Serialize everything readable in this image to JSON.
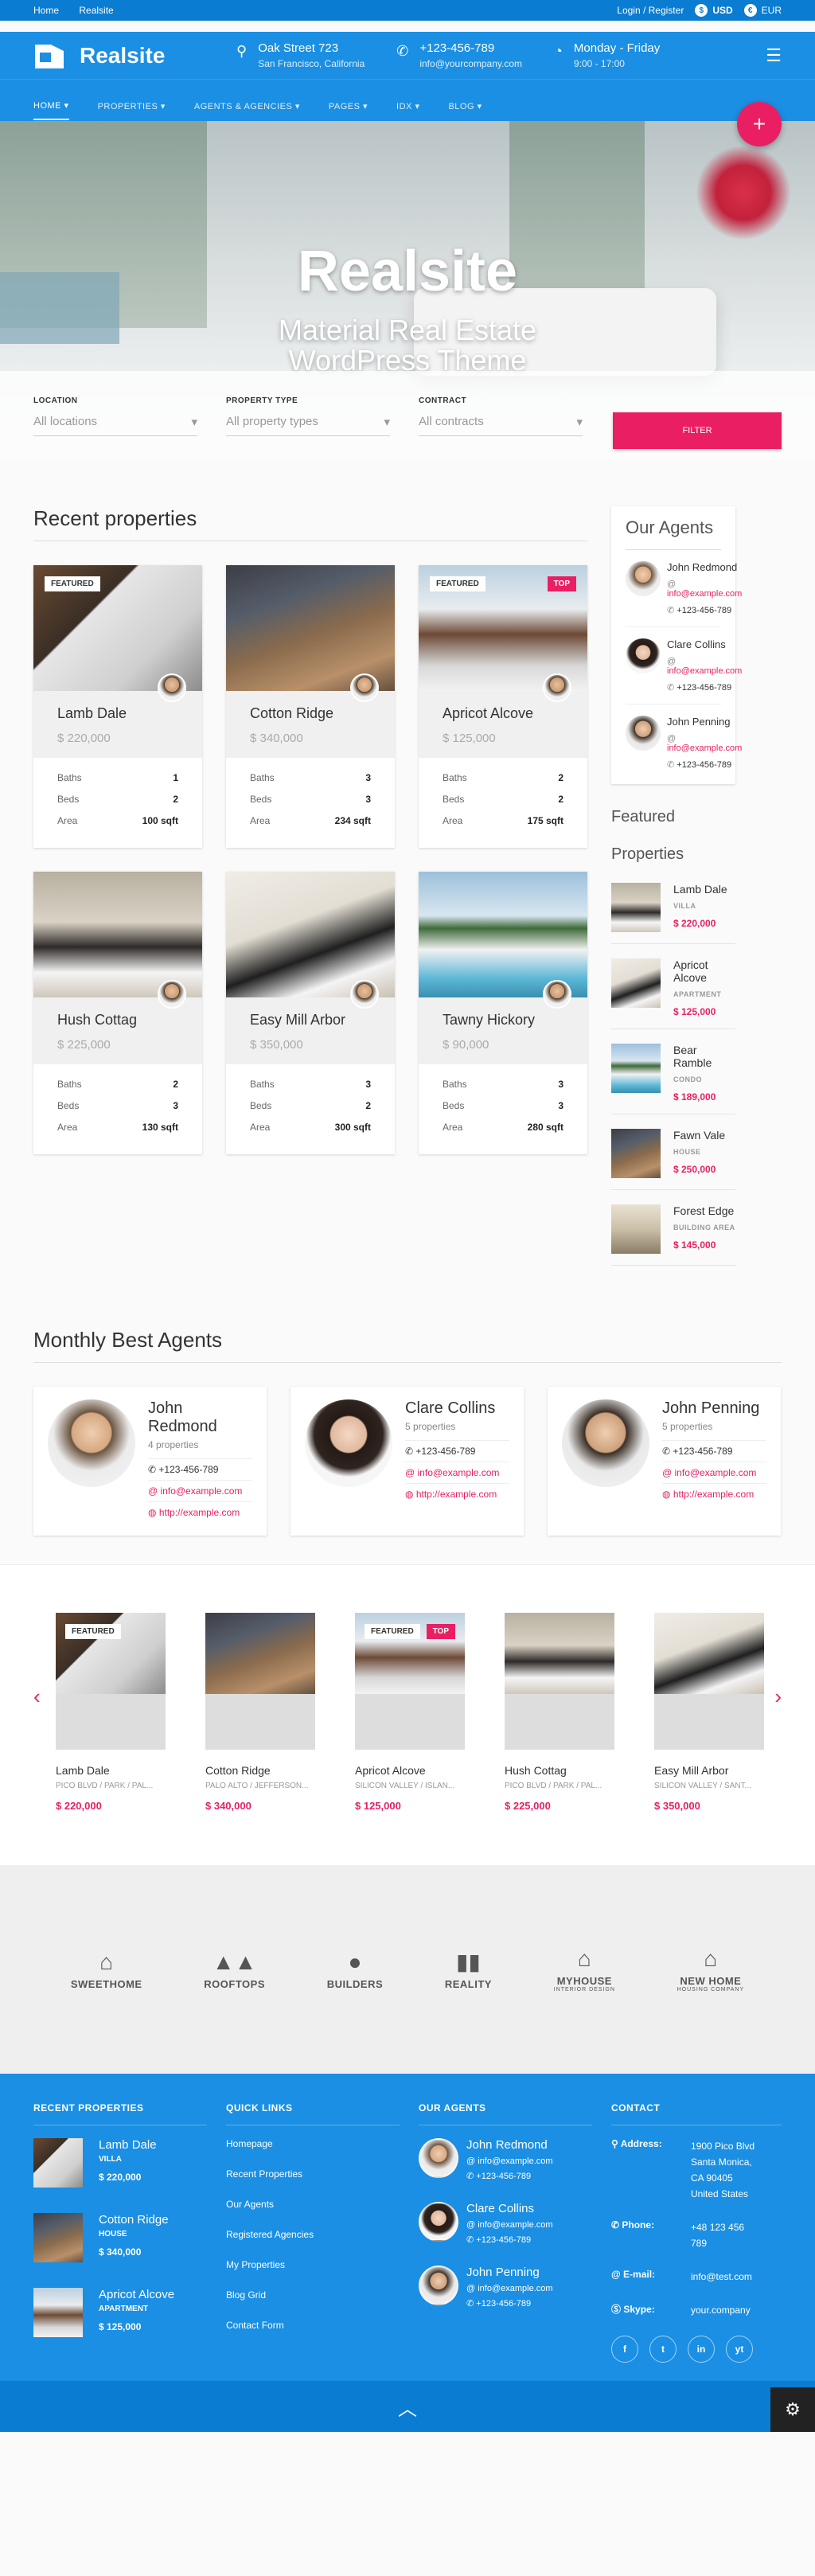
{
  "topbar": {
    "home": "Home",
    "site": "Realsite",
    "login": "Login / Register",
    "usd": "USD",
    "eur": "EUR"
  },
  "header": {
    "logo": "Realsite",
    "addr1": "Oak Street 723",
    "addr2": "San Francisco, California",
    "phone": "+123-456-789",
    "email": "info@yourcompany.com",
    "days": "Monday - Friday",
    "hours": "9:00 - 17:00"
  },
  "nav": [
    "HOME",
    "PROPERTIES",
    "AGENTS & AGENCIES",
    "PAGES",
    "IDX",
    "BLOG"
  ],
  "hero": {
    "title": "Realsite",
    "subtitle1": "Material Real Estate",
    "subtitle2": "WordPress Theme"
  },
  "search": {
    "location_label": "LOCATION",
    "location_val": "All locations",
    "type_label": "PROPERTY TYPE",
    "type_val": "All property types",
    "contract_label": "CONTRACT",
    "contract_val": "All contracts",
    "filter": "FILTER"
  },
  "recent": {
    "title": "Recent properties",
    "baths": "Baths",
    "beds": "Beds",
    "area": "Area",
    "featured": "FEATURED",
    "top": "TOP",
    "items": [
      {
        "name": "Lamb Dale",
        "price": "$ 220,000",
        "baths": "1",
        "beds": "2",
        "area": "100 sqft"
      },
      {
        "name": "Cotton Ridge",
        "price": "$ 340,000",
        "baths": "3",
        "beds": "3",
        "area": "234 sqft"
      },
      {
        "name": "Apricot Alcove",
        "price": "$ 125,000",
        "baths": "2",
        "beds": "2",
        "area": "175 sqft"
      },
      {
        "name": "Hush Cottag",
        "price": "$ 225,000",
        "baths": "2",
        "beds": "3",
        "area": "130 sqft"
      },
      {
        "name": "Easy Mill Arbor",
        "price": "$ 350,000",
        "baths": "3",
        "beds": "2",
        "area": "300 sqft"
      },
      {
        "name": "Tawny Hickory",
        "price": "$ 90,000",
        "baths": "3",
        "beds": "3",
        "area": "280 sqft"
      }
    ]
  },
  "our_agents": {
    "title": "Our Agents",
    "items": [
      {
        "name": "John Redmond",
        "email": "info@example.com",
        "phone": "+123-456-789"
      },
      {
        "name": "Clare Collins",
        "email": "info@example.com",
        "phone": "+123-456-789"
      },
      {
        "name": "John Penning",
        "email": "info@example.com",
        "phone": "+123-456-789"
      }
    ]
  },
  "featured": {
    "title1": "Featured",
    "title2": "Properties",
    "items": [
      {
        "name": "Lamb Dale",
        "kind": "VILLA",
        "price": "$ 220,000"
      },
      {
        "name": "Apricot Alcove",
        "kind": "APARTMENT",
        "price": "$ 125,000"
      },
      {
        "name": "Bear Ramble",
        "kind": "CONDO",
        "price": "$ 189,000"
      },
      {
        "name": "Fawn Vale",
        "kind": "HOUSE",
        "price": "$ 250,000"
      },
      {
        "name": "Forest Edge",
        "kind": "BUILDING AREA",
        "price": "$ 145,000"
      }
    ]
  },
  "best_agents": {
    "title": "Monthly Best Agents",
    "items": [
      {
        "name": "John Redmond",
        "count": "4 properties",
        "phone": "+123-456-789",
        "email": "info@example.com",
        "web": "http://example.com"
      },
      {
        "name": "Clare Collins",
        "count": "5 properties",
        "phone": "+123-456-789",
        "email": "info@example.com",
        "web": "http://example.com"
      },
      {
        "name": "John Penning",
        "count": "5 properties",
        "phone": "+123-456-789",
        "email": "info@example.com",
        "web": "http://example.com"
      }
    ]
  },
  "carousel": {
    "featured": "FEATURED",
    "top": "TOP",
    "items": [
      {
        "name": "Lamb Dale",
        "addr": "PICO BLVD / PARK / PAL...",
        "price": "$ 220,000"
      },
      {
        "name": "Cotton Ridge",
        "addr": "PALO ALTO / JEFFERSON...",
        "price": "$ 340,000"
      },
      {
        "name": "Apricot Alcove",
        "addr": "SILICON VALLEY / ISLAN...",
        "price": "$ 125,000"
      },
      {
        "name": "Hush Cottag",
        "addr": "PICO BLVD / PARK / PAL...",
        "price": "$ 225,000"
      },
      {
        "name": "Easy Mill Arbor",
        "addr": "SILICON VALLEY / SANT...",
        "price": "$ 350,000"
      }
    ]
  },
  "brands": [
    {
      "name": "SWEETHOME",
      "sub": ""
    },
    {
      "name": "ROOFTOPS",
      "sub": ""
    },
    {
      "name": "BUILDERS",
      "sub": ""
    },
    {
      "name": "REALITY",
      "sub": ""
    },
    {
      "name": "MYHOUSE",
      "sub": "INTERIOR DESIGN"
    },
    {
      "name": "NEW HOME",
      "sub": "HOUSING COMPANY"
    }
  ],
  "footer": {
    "recent_h": "RECENT PROPERTIES",
    "links_h": "QUICK LINKS",
    "agents_h": "OUR AGENTS",
    "contact_h": "CONTACT",
    "recent": [
      {
        "name": "Lamb Dale",
        "kind": "VILLA",
        "price": "$ 220,000"
      },
      {
        "name": "Cotton Ridge",
        "kind": "HOUSE",
        "price": "$ 340,000"
      },
      {
        "name": "Apricot Alcove",
        "kind": "APARTMENT",
        "price": "$ 125,000"
      }
    ],
    "links": [
      "Homepage",
      "Recent Properties",
      "Our Agents",
      "Registered Agencies",
      "My Properties",
      "Blog Grid",
      "Contact Form"
    ],
    "agents": [
      {
        "name": "John Redmond",
        "email": "info@example.com",
        "phone": "+123-456-789"
      },
      {
        "name": "Clare Collins",
        "email": "info@example.com",
        "phone": "+123-456-789"
      },
      {
        "name": "John Penning",
        "email": "info@example.com",
        "phone": "+123-456-789"
      }
    ],
    "address_k": "Address:",
    "address_1": "1900 Pico Blvd",
    "address_2": "Santa Monica,",
    "address_3": "CA 90405",
    "address_4": "United States",
    "phone_k": "Phone:",
    "phone_v1": "+48 123 456",
    "phone_v2": "789",
    "email_k": "E-mail:",
    "email_v": "info@test.com",
    "skype_k": "Skype:",
    "skype_v": "your.company",
    "social": [
      "f",
      "t",
      "in",
      "yt"
    ]
  }
}
